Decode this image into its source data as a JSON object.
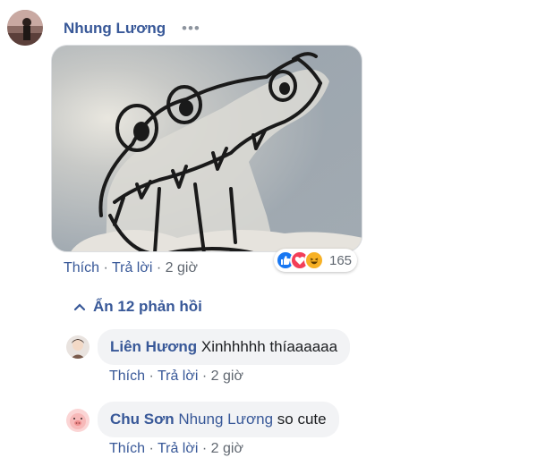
{
  "top_comment": {
    "author": "Nhung Lương",
    "more": "•••",
    "actions": {
      "like": "Thích",
      "reply": "Trả lời",
      "time": "2 giờ",
      "sep": "·"
    },
    "reaction_count": "165",
    "reaction_icons": [
      "like-icon",
      "love-icon",
      "haha-icon"
    ]
  },
  "toggle_replies": {
    "label": "Ẩn 12 phản hồi",
    "icon": "chevron-up-icon"
  },
  "replies": [
    {
      "author": "Liên Hương",
      "mention": "",
      "text": "Xinhhhhh thíaaaaaa",
      "like": "Thích",
      "reply": "Trả lời",
      "time": "2 giờ"
    },
    {
      "author": "Chu Sơn",
      "mention": "Nhung Lương",
      "text": "so cute",
      "like": "Thích",
      "reply": "Trả lời",
      "time": "2 giờ"
    }
  ],
  "colors": {
    "link": "#385898",
    "meta": "#606770",
    "bubble": "#f2f3f5",
    "like": "#1877f2",
    "love": "#f33e58",
    "haha": "#f7b125"
  }
}
